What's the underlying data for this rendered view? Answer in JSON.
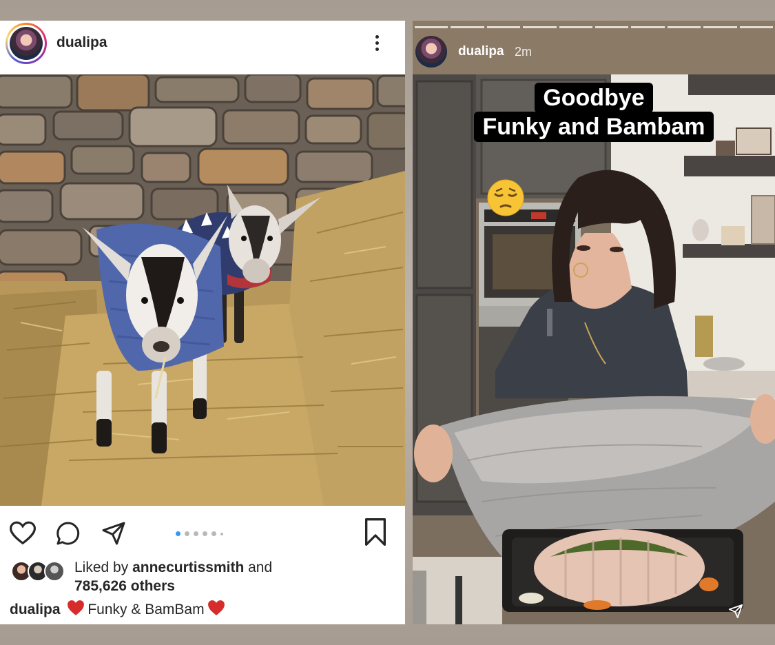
{
  "post": {
    "username": "dualipa",
    "likes": {
      "prefix": "Liked by",
      "liker": "annecurtissmith",
      "joiner": "and",
      "others": "785,626 others"
    },
    "caption": {
      "username": "dualipa",
      "text": "Funky & BamBam"
    },
    "carousel": {
      "count": 6,
      "active_index": 0
    },
    "icons": [
      "more-icon",
      "heart-icon",
      "comment-icon",
      "share-icon",
      "bookmark-icon"
    ]
  },
  "story": {
    "username": "dualipa",
    "time": "2m",
    "caption_line1": "Goodbye",
    "caption_line2": "Funky and Bambam",
    "segments": 10,
    "emoji": "pensive-face"
  },
  "colors": {
    "text": "#262626",
    "heart_emoji": "#d62c2c",
    "emoji_yellow": "#f7c436",
    "story_text": "#ffffff"
  }
}
